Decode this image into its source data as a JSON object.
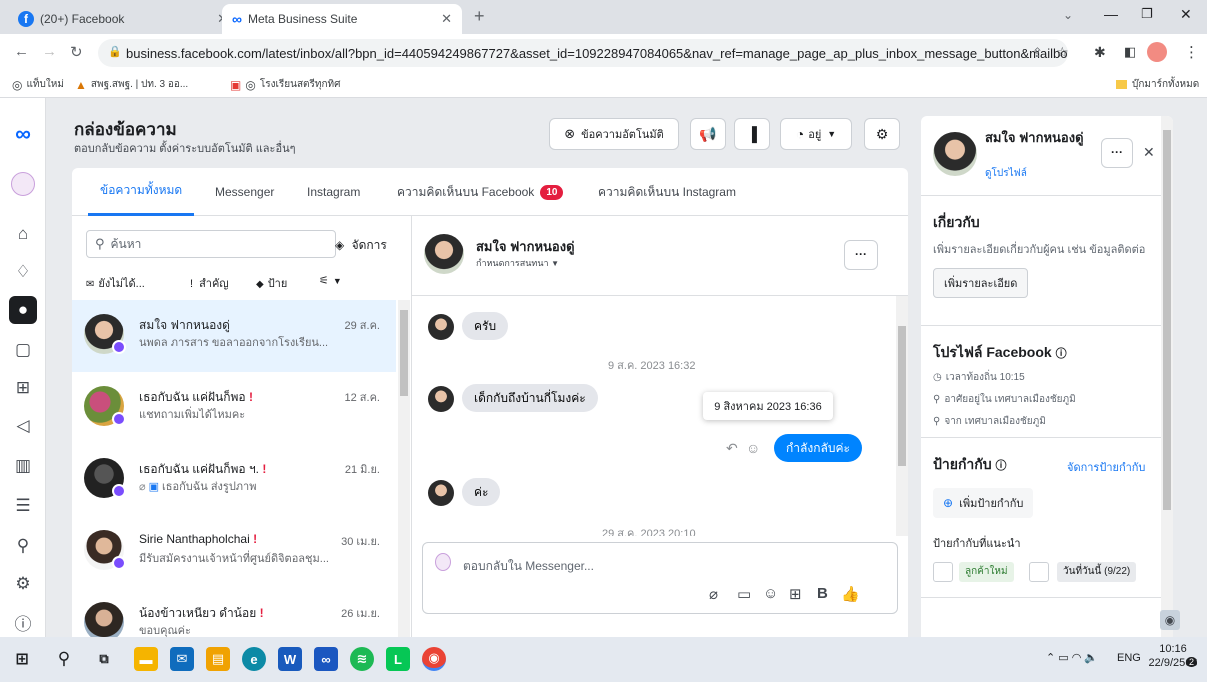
{
  "browser": {
    "tabs": [
      {
        "label": "(20+) Facebook"
      },
      {
        "label": "Meta Business Suite"
      }
    ],
    "new_tab": "+",
    "url": "business.facebook.com/latest/inbox/all?bpn_id=440594249867727&asset_id=109228947084065&nav_ref=manage_page_ap_plus_inbox_message_button&mailbox...",
    "bookmarks": [
      {
        "label": "แท็บใหม่"
      },
      {
        "label": "สพฐ.สพฐ. | ปท. 3 ออ..."
      },
      {
        "label": "โรงเรียนสตรีทุกทิศ"
      }
    ],
    "all_bookmarks": "บุ๊กมาร์กทั้งหมด"
  },
  "header": {
    "title": "กล่องข้อความ",
    "subtitle": "ตอบกลับข้อความ ตั้งค่าระบบอัตโนมัติ และอื่นๆ",
    "auto_btn": "ข้อความอัตโนมัติ",
    "status_btn": "อยู่"
  },
  "tabs": [
    {
      "label": "ข้อความทั้งหมด"
    },
    {
      "label": "Messenger"
    },
    {
      "label": "Instagram"
    },
    {
      "label": "ความคิดเห็นบน Facebook"
    },
    {
      "label": "ความคิดเห็นบน Instagram"
    }
  ],
  "fb_comments_badge": "10",
  "list": {
    "search_placeholder": "ค้นหา",
    "manage": "จัดการ",
    "filters": [
      "ยังไม่ได้...",
      "สำคัญ",
      "ป้าย"
    ],
    "conversations": [
      {
        "name": "สมใจ ฟากหนองดู่",
        "preview": "นพดล ภารสาร ขอลาออกจากโรงเรียน...",
        "date": "29 ส.ค.",
        "warn": ""
      },
      {
        "name": "เธอกับฉัน แค่ฝันก็พอ",
        "preview": "แชทถามเพิ่มได้ไหมคะ",
        "date": "12 ส.ค.",
        "warn": "!"
      },
      {
        "name": "เธอกับฉัน แค่ฝันก็พอ ฯ.",
        "preview": "เธอกับฉัน ส่งรูปภาพ",
        "date": "21 มิ.ย.",
        "warn": "!"
      },
      {
        "name": "Sirie Nanthapholchai",
        "preview": "มีรับสมัครงานเจ้าหน้าที่ศูนย์ดิจิตอลชุม...",
        "date": "30 เม.ย.",
        "warn": "!"
      },
      {
        "name": "น้องข้าวเหนียว ดำน้อย",
        "preview": "ขอบคุณค่ะ",
        "date": "26 เม.ย.",
        "warn": "!"
      }
    ]
  },
  "chat": {
    "name": "สมใจ ฟากหนองดู่",
    "assign": "กำหนดการสนทนา",
    "messages": [
      {
        "text": "ครับ"
      },
      {
        "text": "9 ส.ค. 2023 16:32"
      },
      {
        "text": "เด็กกับถึงบ้านกี่โมงค่ะ"
      },
      {
        "text": "กำลังกลับค่ะ"
      },
      {
        "text": "ค่ะ"
      },
      {
        "text": "29 ส.ค. 2023 20:10"
      }
    ],
    "tooltip": "9 สิงหาคม 2023 16:36",
    "composer_placeholder": "ตอบกลับใน Messenger..."
  },
  "right": {
    "name": "สมใจ ฟากหนองดู่",
    "profile_link": "ดูโปรไฟล์",
    "about_title": "เกี่ยวกับ",
    "about_text": "เพิ่มรายละเอียดเกี่ยวกับผู้คน เช่น ข้อมูลติดต่อ",
    "add_details": "เพิ่มรายละเอียด",
    "fb_profile_title": "โปรไฟล์ Facebook",
    "local_time": "เวลาท้องถิ่น 10:15",
    "lives_in": "อาศัยอยู่ใน เทศบาลเมืองชัยภูมิ",
    "from": "จาก เทศบาลเมืองชัยภูมิ",
    "labels_title": "ป้ายกำกับ",
    "manage_labels": "จัดการป้ายกำกับ",
    "add_label": "เพิ่มป้ายกำกับ",
    "suggested": "ป้ายกำกับที่แนะนำ",
    "tag_new": "ลูกค้าใหม่",
    "tag_today": "วันที่วันนี้ (9/22)"
  },
  "taskbar": {
    "lang": "ENG",
    "time": "10:16",
    "date": "22/9/2566",
    "notif": "2"
  }
}
